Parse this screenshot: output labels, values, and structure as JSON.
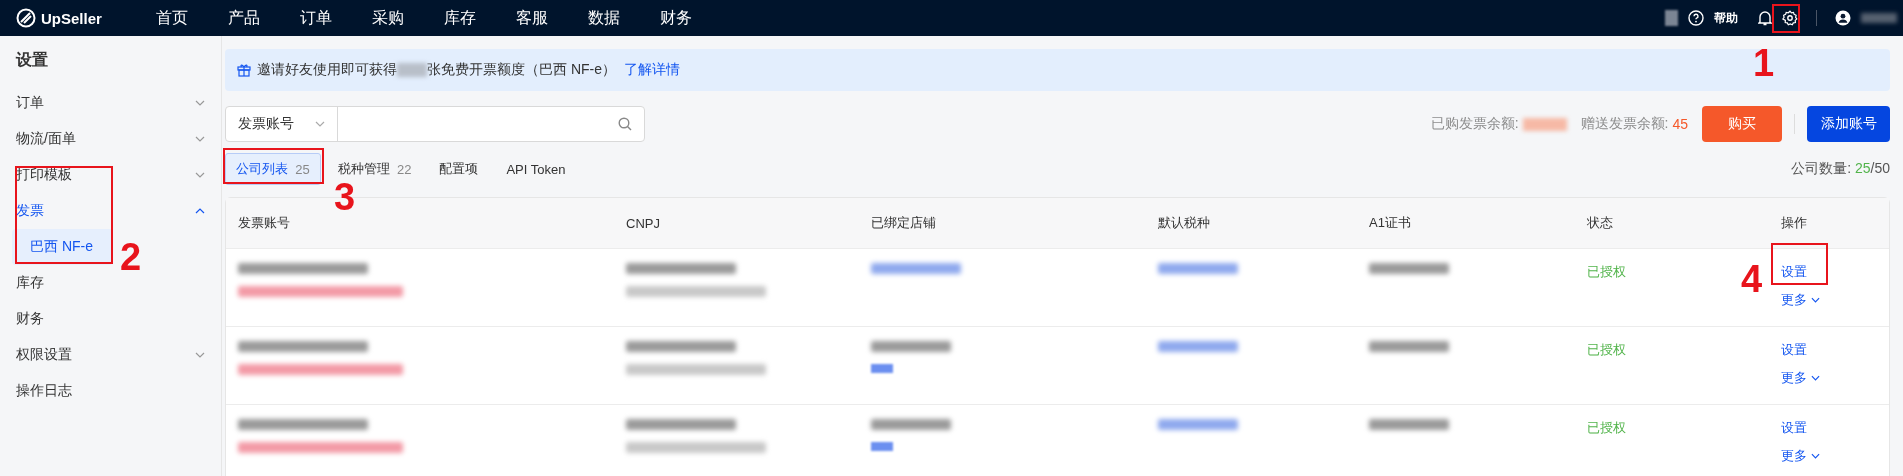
{
  "topbar": {
    "logo": "UpSeller",
    "nav": [
      {
        "label": "首页",
        "selected": false
      },
      {
        "label": "产品",
        "selected": false
      },
      {
        "label": "订单",
        "selected": false
      },
      {
        "label": "采购",
        "selected": false
      },
      {
        "label": "库存",
        "selected": false
      },
      {
        "label": "客服",
        "selected": false
      },
      {
        "label": "数据",
        "selected": false
      },
      {
        "label": "财务",
        "selected": false
      }
    ],
    "help": "帮助"
  },
  "sidebar": {
    "title": "设置",
    "items": [
      {
        "label": "订单",
        "expanded": false,
        "selected": false
      },
      {
        "label": "物流/面单",
        "expanded": false,
        "selected": false
      },
      {
        "label": "打印模板",
        "expanded": false,
        "selected": false
      },
      {
        "label": "发票",
        "expanded": true,
        "selected": true,
        "children": [
          {
            "label": "巴西 NF-e",
            "selected": true
          }
        ]
      },
      {
        "label": "库存",
        "selected": false
      },
      {
        "label": "财务",
        "selected": false
      },
      {
        "label": "权限设置",
        "expanded": false,
        "selected": false
      },
      {
        "label": "操作日志",
        "selected": false
      }
    ]
  },
  "banner": {
    "text_before": "邀请好友使用即可获得",
    "text_after": "张免费开票额度（巴西 NF-e）",
    "link": "了解详情"
  },
  "search": {
    "select": "发票账号"
  },
  "balances": {
    "purchased_label": "已购发票余额:",
    "gift_label": "赠送发票余额:",
    "gift_value": "45"
  },
  "buttons": {
    "buy": "购买",
    "add": "添加账号"
  },
  "tabs": [
    {
      "label": "公司列表",
      "count": "25",
      "selected": true
    },
    {
      "label": "税种管理",
      "count": "22",
      "selected": false
    },
    {
      "label": "配置项",
      "selected": false
    },
    {
      "label": "API Token",
      "selected": false
    }
  ],
  "company_count": {
    "label": "公司数量:",
    "used": "25",
    "total": "/50"
  },
  "table": {
    "columns": [
      "发票账号",
      "CNPJ",
      "已绑定店铺",
      "默认税种",
      "A1证书",
      "状态",
      "操作"
    ],
    "rows": [
      {
        "kind": "link",
        "status": "已授权",
        "actions": [
          "设置",
          "更多"
        ]
      },
      {
        "kind": "tag",
        "status": "已授权",
        "actions": [
          "设置",
          "更多"
        ]
      },
      {
        "kind": "tag",
        "status": "已授权",
        "actions": [
          "设置",
          "更多"
        ]
      }
    ]
  },
  "annotations": [
    {
      "label": "1"
    },
    {
      "label": "2"
    },
    {
      "label": "3"
    },
    {
      "label": "4"
    }
  ]
}
